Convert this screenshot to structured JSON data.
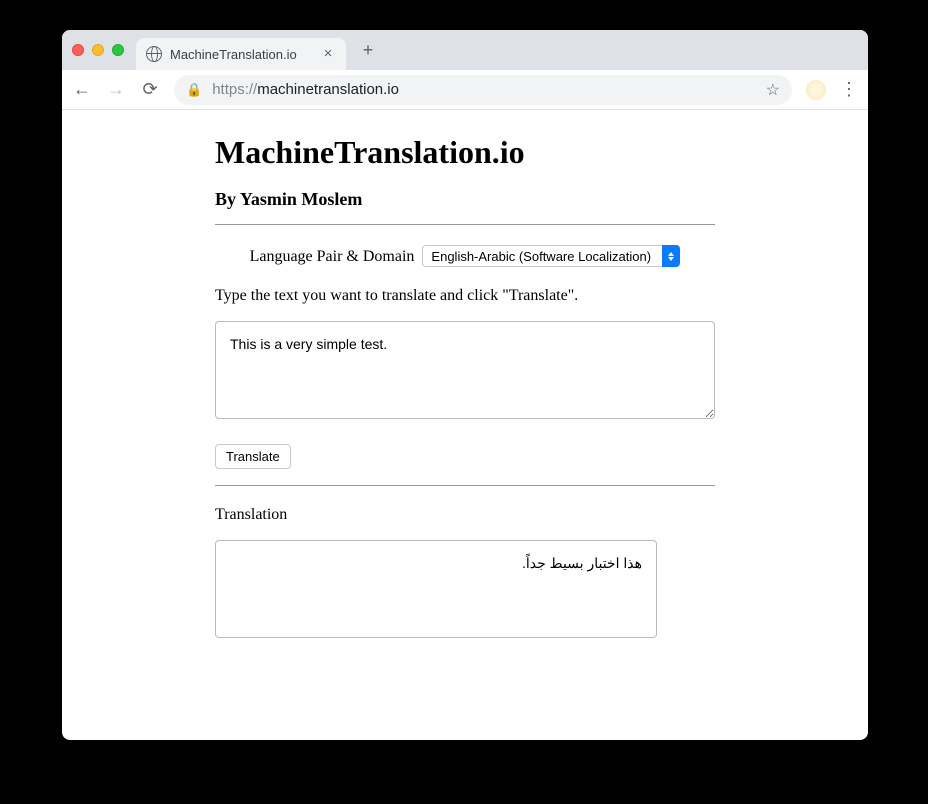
{
  "browser": {
    "tab_title": "MachineTranslation.io",
    "url_scheme": "https://",
    "url_host": "machinetranslation.io"
  },
  "page": {
    "title": "MachineTranslation.io",
    "byline": "By Yasmin Moslem",
    "lang_label": "Language Pair & Domain",
    "lang_selected": "English-Arabic (Software Localization)",
    "instruction": "Type the text you want to translate and click \"Translate\".",
    "input_text": "This is a very simple test.",
    "translate_button": "Translate",
    "output_label": "Translation",
    "output_text": "هذا اختبار بسيط جداً."
  }
}
